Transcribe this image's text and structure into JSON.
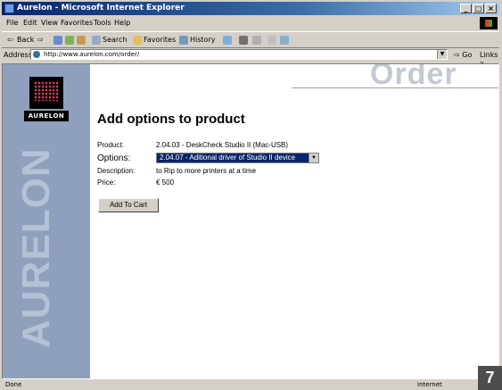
{
  "window": {
    "title": "Aurelon - Microsoft Internet Explorer"
  },
  "menu": {
    "items": [
      "File",
      "Edit",
      "View",
      "Favorites",
      "Tools",
      "Help"
    ]
  },
  "toolbar": {
    "back": "Back",
    "search": "Search",
    "favorites": "Favorites",
    "history": "History"
  },
  "address": {
    "label": "Address",
    "url": "http://www.aurelon.com/order/",
    "go": "Go",
    "links": "Links"
  },
  "brand": {
    "logo_text": "AURELON",
    "vertical_word": "AURELON",
    "section_word": "Order"
  },
  "page": {
    "title": "Add options to product",
    "product_label": "Product:",
    "product_value": "2.04.03 - DeskCheck Studio II (Mac-USB)",
    "options_label": "Options:",
    "options_value": "2.04.07 - Aditional driver of Studio II device",
    "description_label": "Description:",
    "description_value": "to Rip to more printers at a time",
    "price_label": "Price:",
    "price_value": "€ 500",
    "add_to_cart": "Add To Cart"
  },
  "status": {
    "text": "Done",
    "zone": "Internet"
  },
  "badge": "7",
  "colors": {
    "sidebar": "#8ea0bc",
    "titlebar": "#0a246a",
    "selection": "#0a246a"
  }
}
